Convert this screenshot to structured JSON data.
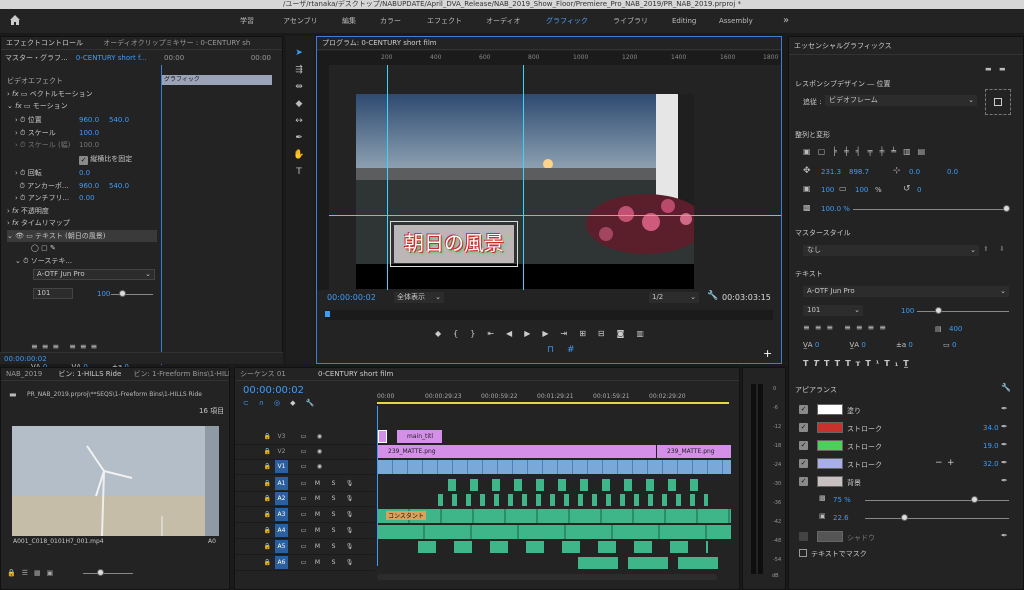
{
  "app": {
    "title_path": "/ユーザ/rtanaka/デスクトップ/NABUPDATE/April_DVA_Release/NAB_2019_Show_Floor/Premiere_Pro_NAB_2019/PR_NAB_2019.prproj *"
  },
  "workspaces": [
    "学習",
    "アセンブリ",
    "編集",
    "カラー",
    "エフェクト",
    "オーディオ",
    "グラフィック",
    "ライブラリ",
    "Editing",
    "Assembly"
  ],
  "active_workspace": "グラフィック",
  "effect_controls": {
    "tab1": "エフェクトコントロール",
    "tab2": "オーディオクリップミキサー : 0-CENTURY sh",
    "master": "マスター・グラフ...",
    "seq": "0-CENTURY short f...",
    "time_start": "00:00",
    "time_end": "00:00",
    "section": "ビデオエフェクト",
    "clip_name": "グラフィック",
    "vector_motion": "ベクトルモーション",
    "motion": "モーション",
    "position_label": "位置",
    "position_x": "960.0",
    "position_y": "540.0",
    "scale_label": "スケール",
    "scale_val": "100.0",
    "scale_w_label": "スケール (幅)",
    "scale_w_val": "100.0",
    "uniform_label": "縦横比を固定",
    "rotation_label": "回転",
    "rotation_val": "0.0",
    "anchor_label": "アンカーポ...",
    "anchor_x": "960.0",
    "anchor_y": "540.0",
    "antiflicker_label": "アンチフリ...",
    "antiflicker_val": "0.00",
    "opacity_label": "不透明度",
    "timeremap_label": "タイムリマップ",
    "text_layer": "テキスト (朝日の風景)",
    "source_text": "ソーステキ...",
    "font": "A-OTF Jun Pro",
    "font_size": "101",
    "tracking": "100",
    "va1": "0",
    "va2": "0",
    "va3": "0",
    "time": "00:00:00:02"
  },
  "program": {
    "title": "プログラム: 0-CENTURY short film",
    "ruler": [
      "200",
      "400",
      "600",
      "800",
      "1000",
      "1200",
      "1400",
      "1600",
      "1800"
    ],
    "overlay_text": "朝日の風景",
    "timecode": "00:00:00:02",
    "fit": "全体表示",
    "quality": "1/2",
    "duration": "00:03:03:15"
  },
  "project": {
    "tab0": "NAB_2019",
    "tab1": "ビン: 1-HILLS Ride",
    "tab2": "ビン: 1-Freeform Bins\\1-HILLS Ride",
    "path": "PR_NAB_2019.prproj\\**SEQS\\1-Freeform Bins\\1-HILLS Ride",
    "count": "16 項目",
    "clip_name": "A001_C018_0101H7_001.mp4",
    "clip_name2": "A0"
  },
  "timeline": {
    "tab_seq1": "シーケンス 01",
    "tab_seq2": "0-CENTURY short film",
    "timecode": "00:00:00:02",
    "ruler": [
      "00:00",
      "00:00:29:23",
      "00:00:59:22",
      "00:01:29:21",
      "00:01:59:21",
      "00:02:29:20"
    ],
    "video_tracks": [
      "V3",
      "V2",
      "V1"
    ],
    "audio_tracks": [
      "A1",
      "A2",
      "A3",
      "A4",
      "A5",
      "A6"
    ],
    "clip_v3": "main_titl",
    "clip_v2a": "239_MATTE.png",
    "clip_v2b": "239_MATTE.png",
    "audio_label": "コンスタント"
  },
  "meter": {
    "labels": [
      "0",
      "-6",
      "-12",
      "-18",
      "-24",
      "-30",
      "-36",
      "-42",
      "-48",
      "-54",
      "dB"
    ]
  },
  "essential": {
    "title": "エッセンシャルグラフィックス",
    "responsive": "レスポンシブデザイン ― 位置",
    "follow_label": "追従 :",
    "follow_val": "ビデオフレーム",
    "align": "整列と変形",
    "pos_x": "231.3",
    "pos_y": "898.7",
    "anchor_x": "0.0",
    "anchor_y": "0.0",
    "scale": "100",
    "scale2": "100",
    "pct": "%",
    "rot": "0",
    "opacity": "100.0 %",
    "master_style": "マスタースタイル",
    "master_val": "なし",
    "text_section": "テキスト",
    "font": "A-OTF Jun Pro",
    "size": "101",
    "size_val": "100",
    "leading": "400",
    "t1": "0",
    "t2": "0",
    "t3": "0",
    "t4": "0",
    "appearance": "アピアランス",
    "fill": "塗り",
    "stroke1": "ストローク",
    "stroke2": "ストローク",
    "stroke3": "ストローク",
    "stroke1_val": "34.0",
    "stroke2_val": "19.0",
    "stroke3_val": "32.0",
    "bg": "背景",
    "bg_opacity": "75 %",
    "bg_size": "22.6",
    "shadow": "シャドウ",
    "mask": "テキストでマスク",
    "colors": {
      "fill": "#ffffff",
      "stroke1": "#c8312c",
      "stroke2": "#4ecf5b",
      "stroke3": "#a8aee8",
      "bg": "#c9c1c1",
      "shadow": "#555555"
    }
  }
}
